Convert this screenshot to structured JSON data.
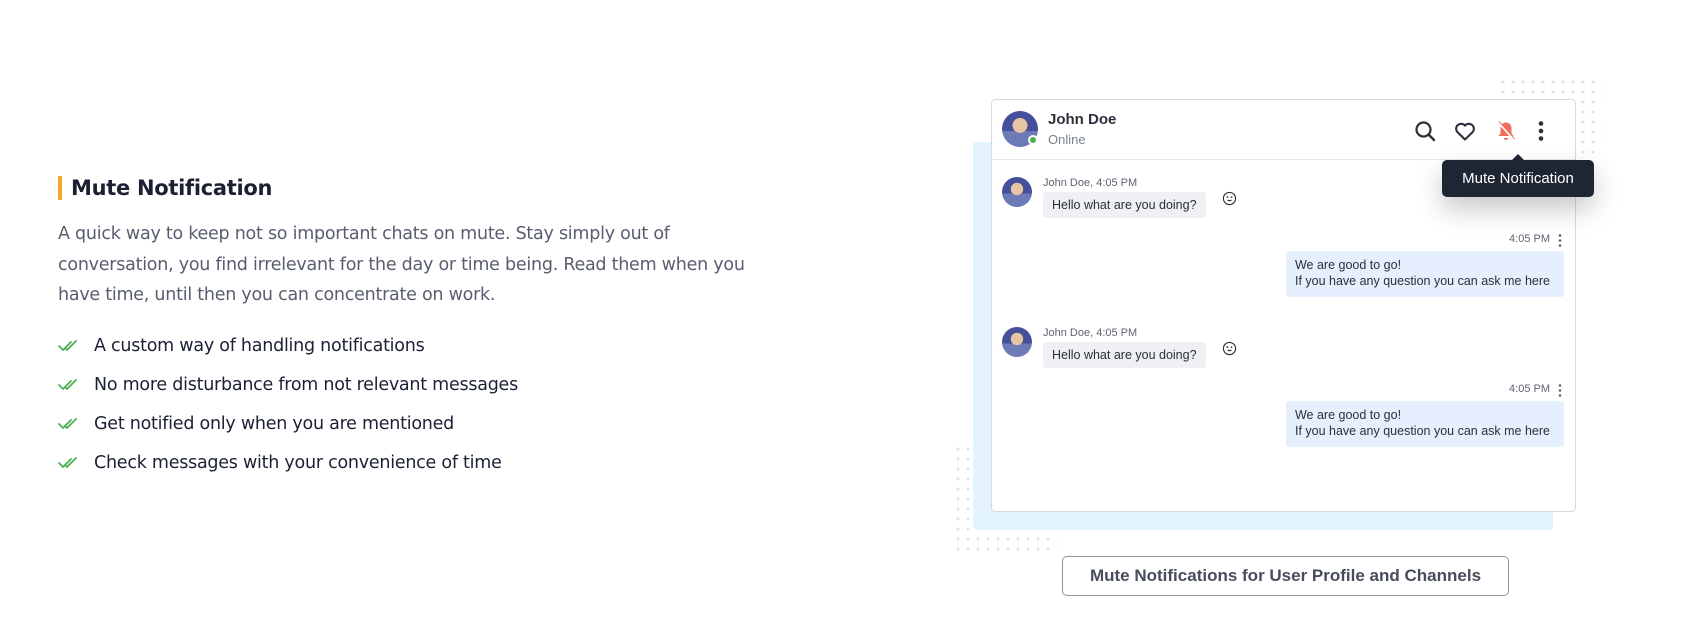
{
  "feature": {
    "title": "Mute Notification",
    "description": "A quick way to keep not so important chats on mute. Stay simply out of conversation, you find irrelevant for the day or time being. Read them when you have time, until then you can concentrate on work.",
    "bullets": [
      "A custom way of handling notifications",
      "No more disturbance from not relevant messages",
      "Get notified only when you are mentioned",
      "Check messages with your convenience of time"
    ],
    "accent_color": "#f5a623",
    "check_color": "#4cb050"
  },
  "chat": {
    "contact_name": "John Doe",
    "status": "Online",
    "header_icons": [
      "search-icon",
      "heart-icon",
      "bell-muted-icon",
      "more-vertical-icon"
    ],
    "muted_icon_color": "#f26b5b",
    "tooltip": "Mute Notification",
    "messages": [
      {
        "direction": "in",
        "meta": "John Doe, 4:05 PM",
        "text": "Hello what are you doing?"
      },
      {
        "direction": "out",
        "time": "4:05 PM",
        "lines": [
          "We are good to go!",
          "If you have any question you can ask me here"
        ]
      },
      {
        "direction": "in",
        "meta": "John Doe, 4:05 PM",
        "text": "Hello what are you doing?"
      },
      {
        "direction": "out",
        "time": "4:05 PM",
        "lines": [
          "We are good to go!",
          "If you have any question you can ask me here"
        ]
      }
    ]
  },
  "caption_button": "Mute Notifications for User Profile and Channels"
}
